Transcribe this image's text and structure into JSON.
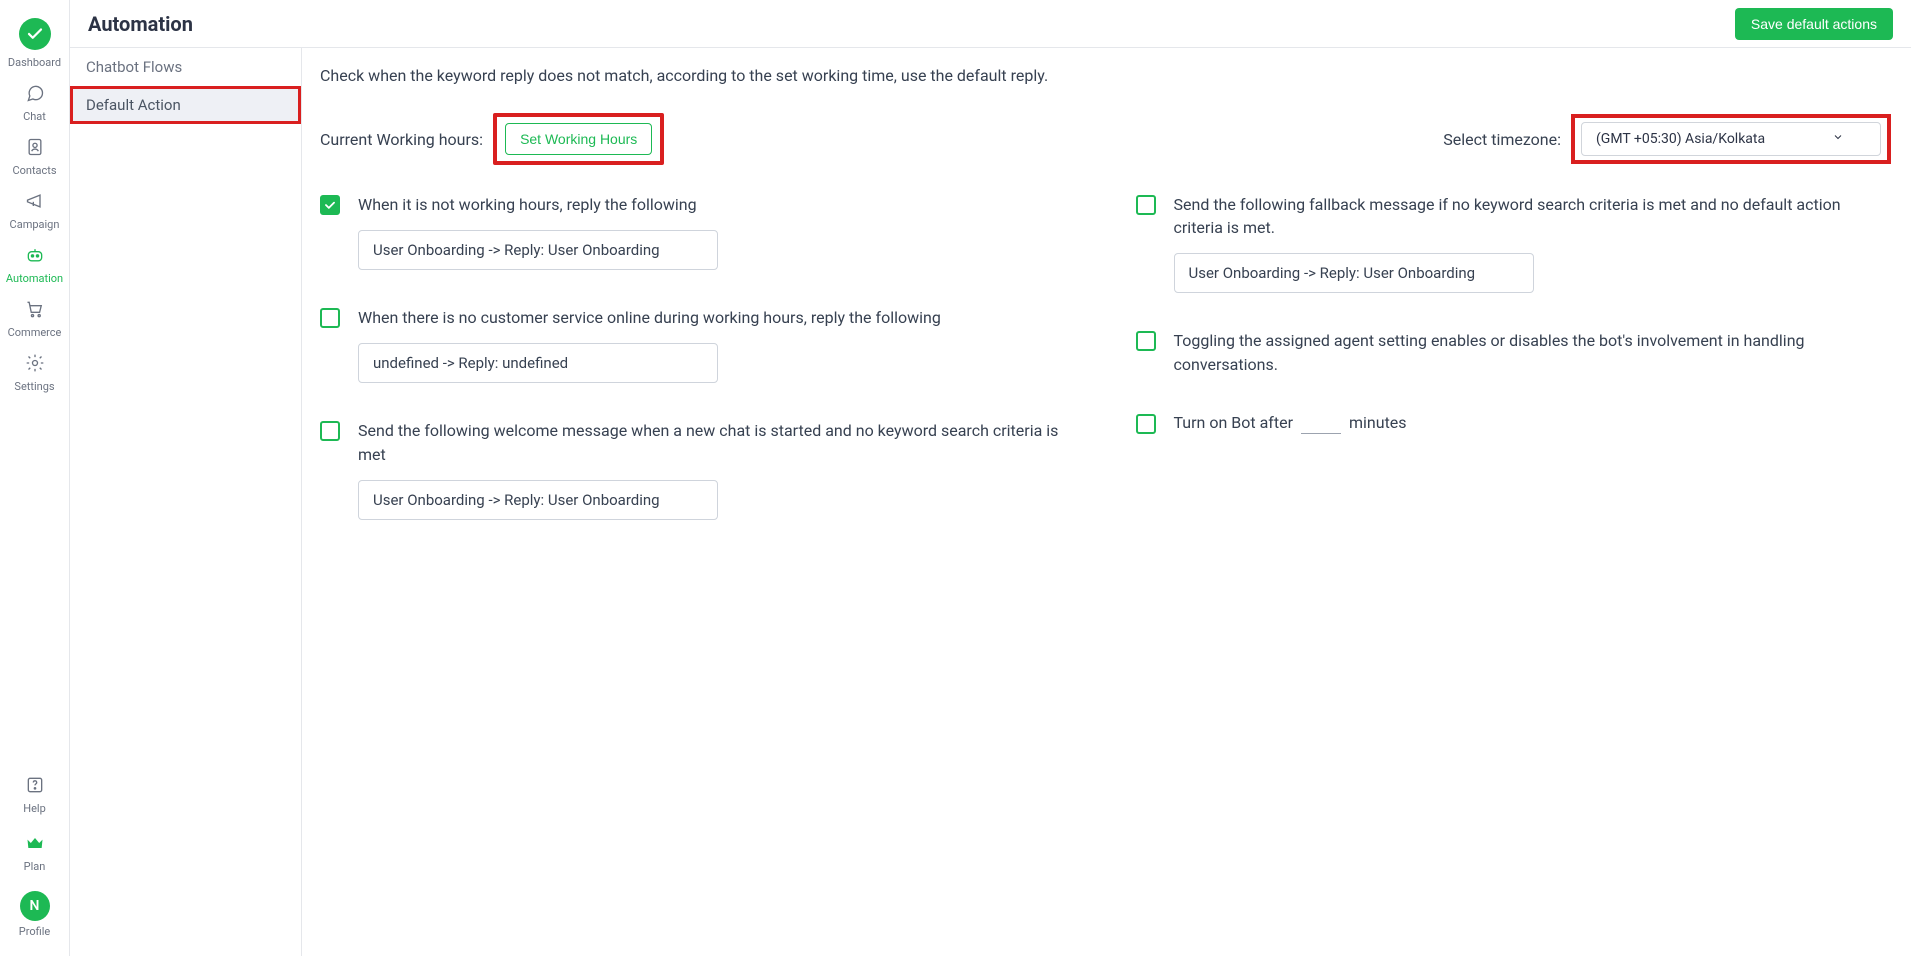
{
  "header": {
    "title": "Automation",
    "save_btn": "Save default actions"
  },
  "rail": {
    "items": [
      {
        "key": "dashboard",
        "label": "Dashboard"
      },
      {
        "key": "chat",
        "label": "Chat"
      },
      {
        "key": "contacts",
        "label": "Contacts"
      },
      {
        "key": "campaign",
        "label": "Campaign"
      },
      {
        "key": "automation",
        "label": "Automation"
      },
      {
        "key": "commerce",
        "label": "Commerce"
      },
      {
        "key": "settings",
        "label": "Settings"
      }
    ],
    "bottom": [
      {
        "key": "help",
        "label": "Help"
      },
      {
        "key": "plan",
        "label": "Plan"
      },
      {
        "key": "profile",
        "label": "Profile"
      }
    ],
    "avatar_initial": "N"
  },
  "subnav": {
    "items": [
      {
        "label": "Chatbot Flows",
        "active": false
      },
      {
        "label": "Default Action",
        "active": true
      }
    ]
  },
  "intro": "Check when the keyword reply does not match, according to the set working time, use the default reply.",
  "working_hours": {
    "label": "Current Working hours:",
    "btn": "Set Working Hours"
  },
  "timezone": {
    "label": "Select timezone:",
    "selected": "(GMT +05:30) Asia/Kolkata"
  },
  "options_left": [
    {
      "checked": true,
      "label": "When it is not working hours, reply the following",
      "reply": "User Onboarding -> Reply: User Onboarding"
    },
    {
      "checked": false,
      "label": "When there is no customer service online during working hours, reply the following",
      "reply": "undefined -> Reply: undefined"
    },
    {
      "checked": false,
      "label": "Send the following welcome message when a new chat is started and no keyword search criteria is met",
      "reply": "User Onboarding -> Reply: User Onboarding"
    }
  ],
  "options_right": [
    {
      "checked": false,
      "label": "Send the following fallback message if no keyword search criteria is met and no default action criteria is met.",
      "reply": "User Onboarding -> Reply: User Onboarding"
    },
    {
      "checked": false,
      "label": "Toggling the assigned agent setting enables or disables the bot's involvement in handling conversations."
    }
  ],
  "bot_after": {
    "checked": false,
    "prefix": "Turn on Bot after",
    "suffix": "minutes",
    "value": ""
  }
}
